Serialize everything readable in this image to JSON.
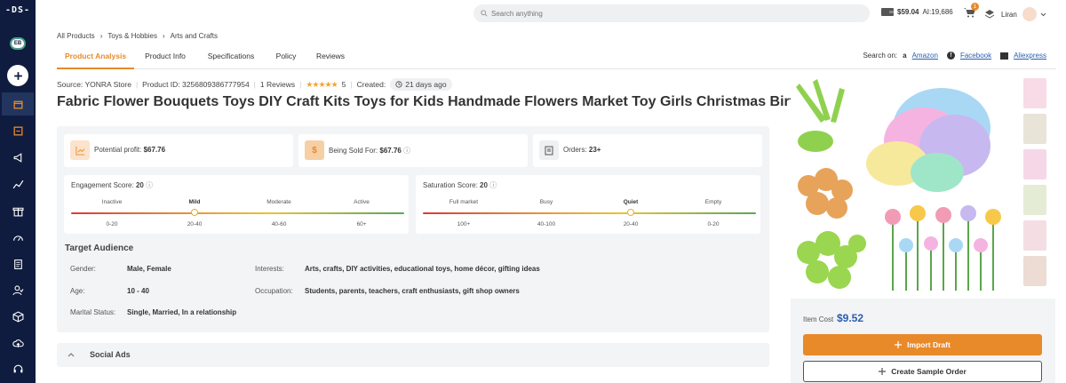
{
  "app": {
    "logo": "-DS-"
  },
  "sidebar": {
    "badge": "EB"
  },
  "topbar": {
    "search_placeholder": "Search anything",
    "balance": "$59.04",
    "ai_credits": "AI:19,686",
    "notifications": "1",
    "user": "Liran"
  },
  "breadcrumb": [
    "All Products",
    "Toys & Hobbies",
    "Arts and Crafts"
  ],
  "tabs": [
    "Product Analysis",
    "Product Info",
    "Specifications",
    "Policy",
    "Reviews"
  ],
  "search_on": {
    "label": "Search on:",
    "links": [
      "Amazon",
      "Facebook",
      "Aliexpress"
    ]
  },
  "meta": {
    "source": "Source: YONRA Store",
    "product_id": "Product ID: 3256809386777954",
    "reviews": "1 Reviews",
    "rating": "5",
    "created_label": "Created:",
    "created_value": "21 days ago"
  },
  "product": {
    "title": "Fabric Flower Bouquets Toys DIY Craft Kits Toys for Kids Handmade Flowers Market Toy Girls Christmas Birthday Gift"
  },
  "stats": {
    "profit": {
      "label": "Potential profit:",
      "value": "$67.76"
    },
    "sold": {
      "label": "Being Sold For:",
      "value": "$67.76"
    },
    "orders": {
      "label": "Orders:",
      "value": "23+"
    }
  },
  "engagement": {
    "label": "Engagement Score:",
    "value": "20",
    "levels": [
      "Inactive",
      "Mild",
      "Moderate",
      "Active"
    ],
    "ranges": [
      "0-20",
      "20-40",
      "40-60",
      "60+"
    ],
    "active_index": 1
  },
  "saturation": {
    "label": "Saturation Score:",
    "value": "20",
    "levels": [
      "Full market",
      "Busy",
      "Quiet",
      "Empty"
    ],
    "ranges": [
      "100+",
      "40-100",
      "20-40",
      "0-20"
    ],
    "active_index": 2
  },
  "audience": {
    "heading": "Target Audience",
    "gender_label": "Gender:",
    "gender": "Male, Female",
    "age_label": "Age:",
    "age": "10 - 40",
    "marital_label": "Marital Status:",
    "marital": "Single, Married, In a relationship",
    "interests_label": "Interests:",
    "interests": "Arts, crafts, DIY activities, educational toys, home décor, gifting ideas",
    "occupation_label": "Occupation:",
    "occupation": "Students, parents, teachers, craft enthusiasts, gift shop owners"
  },
  "social": {
    "label": "Social Ads"
  },
  "purchase": {
    "item_cost_label": "Item Cost",
    "item_cost": "$9.52",
    "import_label": "Import Draft",
    "sample_label": "Create Sample Order"
  },
  "colors": {
    "sidebar": "#0f1c3f",
    "accent": "#e88a2a",
    "link": "#2a5db0"
  }
}
